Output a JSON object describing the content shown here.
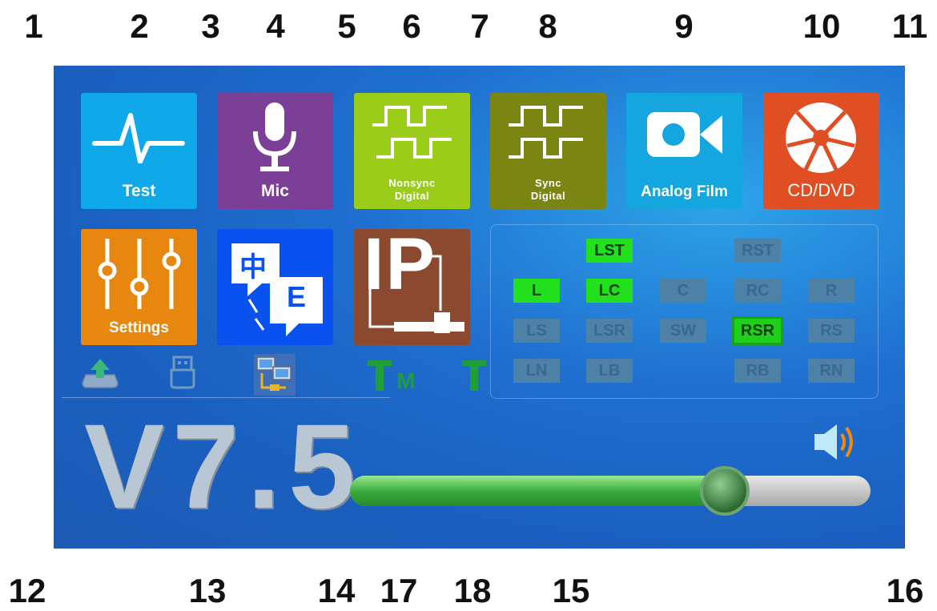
{
  "callouts": [
    "1",
    "2",
    "3",
    "4",
    "5",
    "6",
    "7",
    "8",
    "9",
    "10",
    "11",
    "12",
    "13",
    "14",
    "15",
    "16",
    "17",
    "18"
  ],
  "tiles": {
    "test": {
      "label": "Test",
      "color": "#0fa9ea"
    },
    "mic": {
      "label": "Mic",
      "color": "#7b3f98"
    },
    "nonsync": {
      "label_line1": "Nonsync",
      "label_line2": "Digital",
      "color": "#9acc19"
    },
    "sync": {
      "label_line1": "Sync",
      "label_line2": "Digital",
      "color": "#7b8512"
    },
    "analog": {
      "label": "Analog Film",
      "color": "#15a6e0"
    },
    "cddvd": {
      "label": "CD/DVD",
      "color": "#e04e24"
    },
    "settings": {
      "label": "Settings",
      "color": "#e7870f"
    },
    "language": {
      "label_cn": "中",
      "label_e": "E",
      "color": "#0a52f0"
    },
    "ip": {
      "label": "IP",
      "color": "#8b4a2f"
    }
  },
  "channels": [
    {
      "name": "LST",
      "state": "on"
    },
    {
      "name": "RST",
      "state": "off"
    },
    {
      "name": "L",
      "state": "on"
    },
    {
      "name": "LC",
      "state": "on"
    },
    {
      "name": "C",
      "state": "off"
    },
    {
      "name": "RC",
      "state": "off"
    },
    {
      "name": "R",
      "state": "off"
    },
    {
      "name": "LS",
      "state": "off"
    },
    {
      "name": "LSR",
      "state": "off"
    },
    {
      "name": "SW",
      "state": "off"
    },
    {
      "name": "RSR",
      "state": "on"
    },
    {
      "name": "RS",
      "state": "off"
    },
    {
      "name": "LN",
      "state": "off"
    },
    {
      "name": "LB",
      "state": "off"
    },
    {
      "name": "RB",
      "state": "off"
    },
    {
      "name": "RN",
      "state": "off"
    }
  ],
  "status": {
    "tm_label": "M",
    "version": "V7.5"
  },
  "volume": {
    "level": 0.72
  },
  "icons": [
    "upload-icon",
    "usb-icon",
    "network-icon",
    "tm-icon",
    "t-icon",
    "speaker-icon"
  ]
}
